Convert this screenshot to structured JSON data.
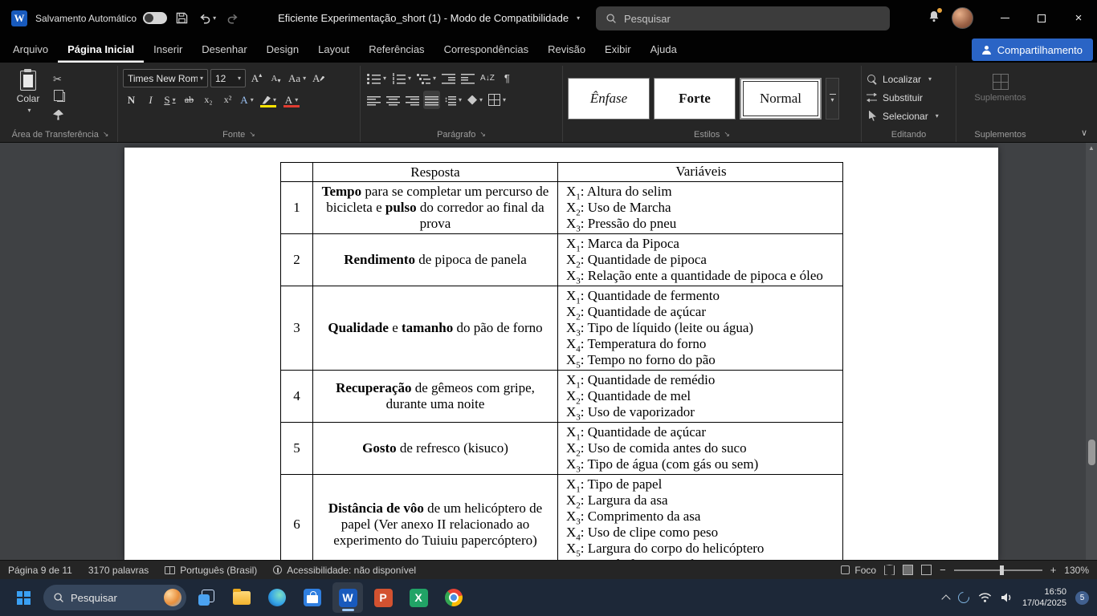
{
  "titlebar": {
    "autosave_label": "Salvamento Automático",
    "doc_title": "Eficiente Experimentação_short (1)  -  Modo de Compatibilidade",
    "search_placeholder": "Pesquisar"
  },
  "ribbon": {
    "tabs": [
      "Arquivo",
      "Página Inicial",
      "Inserir",
      "Desenhar",
      "Design",
      "Layout",
      "Referências",
      "Correspondências",
      "Revisão",
      "Exibir",
      "Ajuda"
    ],
    "active_tab": "Página Inicial",
    "share_label": "Compartilhamento",
    "clipboard": {
      "paste_label": "Colar",
      "group_label": "Área de Transferência"
    },
    "font": {
      "family": "Times New Roman",
      "size": "12",
      "case_label": "Aa",
      "bold_label": "N",
      "italic_label": "I",
      "underline_label": "S",
      "strike_label": "ab",
      "subscript_label": "x₂",
      "superscript_label": "x²",
      "effects_label": "A",
      "fontcolor_label": "A",
      "group_label": "Fonte"
    },
    "paragraph": {
      "sort_label": "A↓Z",
      "pilcrow_label": "¶",
      "group_label": "Parágrafo"
    },
    "styles": {
      "group_label": "Estilos",
      "items": [
        "Ênfase",
        "Forte",
        "Normal"
      ],
      "selected": "Normal"
    },
    "editing": {
      "group_label": "Editando",
      "items": [
        "Localizar",
        "Substituir",
        "Selecionar"
      ]
    },
    "addins": {
      "group_label": "Suplementos",
      "button_label": "Suplementos"
    }
  },
  "document": {
    "table": {
      "headers": [
        "Resposta",
        "Variáveis"
      ],
      "rows": [
        {
          "num": "1",
          "resposta": [
            {
              "b": 1,
              "t": "Tempo"
            },
            {
              "t": " para se completar um percurso de bicicleta e "
            },
            {
              "b": 1,
              "t": "pulso"
            },
            {
              "t": " do corredor ao final da prova"
            }
          ],
          "variaveis": [
            "Altura do selim",
            "Uso de Marcha",
            "Pressão do pneu"
          ]
        },
        {
          "num": "2",
          "resposta": [
            {
              "b": 1,
              "t": "Rendimento"
            },
            {
              "t": " de pipoca de panela"
            }
          ],
          "variaveis": [
            "Marca da Pipoca",
            "Quantidade de pipoca",
            "Relação ente a quantidade de pipoca e óleo"
          ]
        },
        {
          "num": "3",
          "resposta": [
            {
              "b": 1,
              "t": "Qualidade"
            },
            {
              "t": " e "
            },
            {
              "b": 1,
              "t": "tamanho"
            },
            {
              "t": " do pão de forno"
            }
          ],
          "variaveis": [
            "Quantidade de fermento",
            "Quantidade de açúcar",
            "Tipo de líquido (leite ou água)",
            "Temperatura do forno",
            "Tempo no forno do pão"
          ]
        },
        {
          "num": "4",
          "resposta": [
            {
              "b": 1,
              "t": "Recuperação"
            },
            {
              "t": " de gêmeos com gripe, durante uma noite"
            }
          ],
          "variaveis": [
            "Quantidade de remédio",
            "Quantidade de mel",
            "Uso de vaporizador"
          ]
        },
        {
          "num": "5",
          "resposta": [
            {
              "b": 1,
              "t": "Gosto"
            },
            {
              "t": " de refresco (kisuco)"
            }
          ],
          "variaveis": [
            "Quantidade de açúcar",
            "Uso de comida antes do suco",
            "Tipo de água (com gás ou sem)"
          ]
        },
        {
          "num": "6",
          "resposta": [
            {
              "b": 1,
              "t": "Distância de vôo"
            },
            {
              "t": " de um helicóptero de papel (Ver anexo II relacionado ao experimento do Tuiuiu papercóptero)"
            }
          ],
          "variaveis": [
            "Tipo de papel",
            "Largura da asa",
            "Comprimento da asa",
            "Uso de clipe como peso",
            "Largura do corpo do helicóptero",
            "Uso de fita para colar as asas"
          ]
        }
      ]
    }
  },
  "statusbar": {
    "page": "Página 9 de 11",
    "words": "3170 palavras",
    "language": "Português (Brasil)",
    "accessibility": "Acessibilidade: não disponível",
    "focus": "Foco",
    "zoom": "130%"
  },
  "taskbar": {
    "search_placeholder": "Pesquisar",
    "time": "16:50",
    "date": "17/04/2025",
    "badge": "5"
  },
  "colors": {
    "share_blue": "#2a64c5",
    "word_blue": "#185abd",
    "excel_green": "#21a366",
    "powerpoint_orange": "#d35230",
    "highlight_yellow": "#ffe400",
    "fontcolor_red": "#e03c31"
  }
}
